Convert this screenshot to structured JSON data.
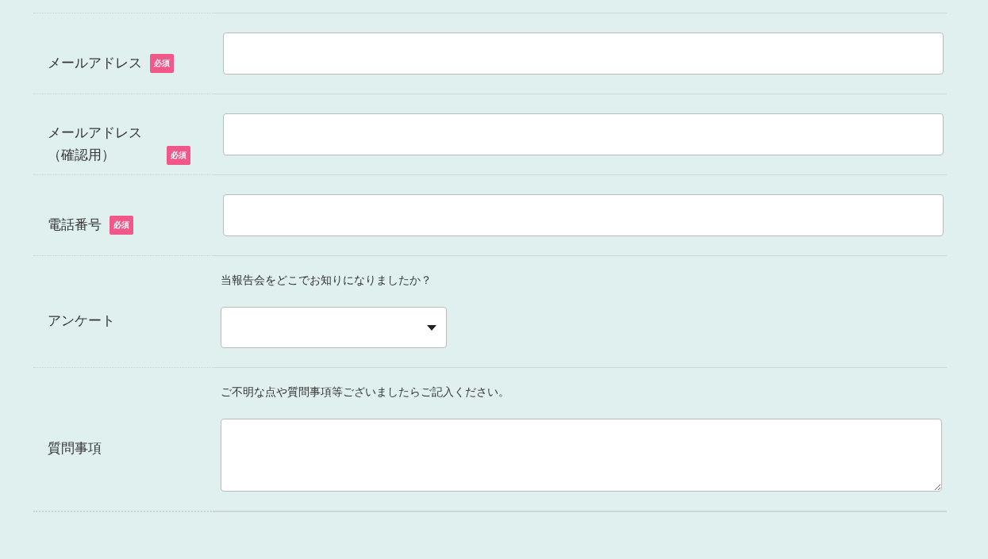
{
  "fields": [
    {
      "label": "メールアドレス",
      "required": true,
      "badge": "必須",
      "kind": "text"
    },
    {
      "label": "メールアドレス（確認用）",
      "required": true,
      "badge": "必須",
      "kind": "text"
    },
    {
      "label": "電話番号",
      "required": true,
      "badge": "必須",
      "kind": "text"
    },
    {
      "label": "アンケート",
      "required": false,
      "kind": "select",
      "note": "当報告会をどこでお知りになりましたか？"
    },
    {
      "label": "質問事項",
      "required": false,
      "kind": "textarea",
      "note": "ご不明な点や質問事項等ございましたらご記入ください。"
    }
  ]
}
